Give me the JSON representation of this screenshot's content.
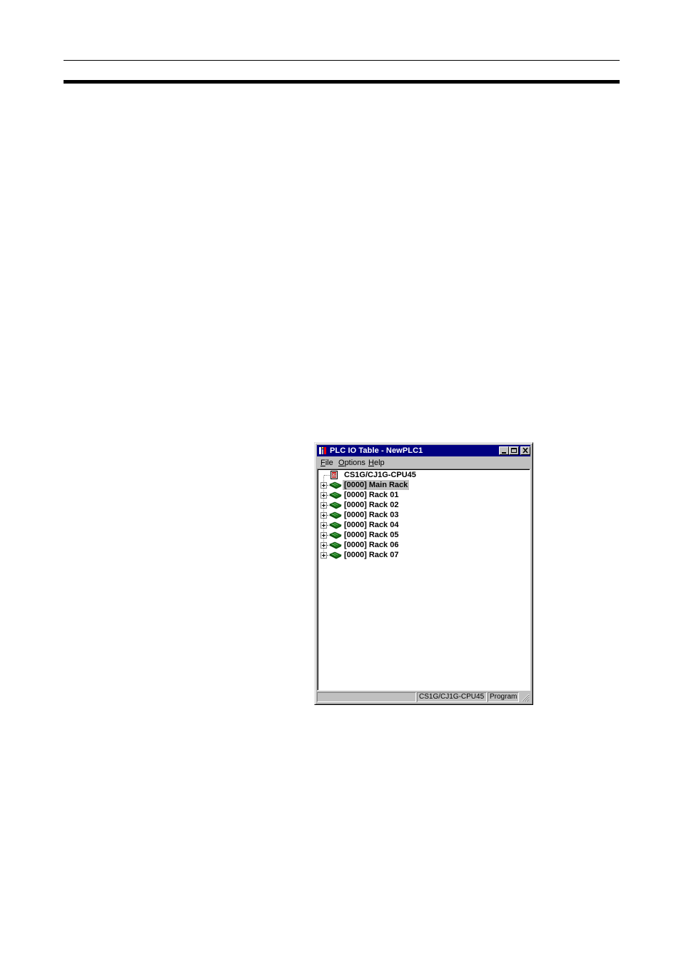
{
  "window": {
    "title": "PLC IO Table - NewPLC1",
    "icon": "plc-io-table-app-icon"
  },
  "title_buttons": {
    "minimize_icon": "minimize-icon",
    "maximize_icon": "maximize-icon",
    "close_icon": "close-icon"
  },
  "menu": {
    "items": [
      {
        "accel": "F",
        "rest": "ile"
      },
      {
        "accel": "O",
        "rest": "ptions"
      },
      {
        "accel": "H",
        "rest": "elp"
      }
    ]
  },
  "tree": {
    "root": {
      "label": "CS1G/CJ1G-CPU45",
      "icon": "cpu-icon"
    },
    "nodes": [
      {
        "label": "[0000] Main Rack",
        "icon": "rack-icon",
        "selected": true
      },
      {
        "label": "[0000] Rack 01",
        "icon": "rack-icon"
      },
      {
        "label": "[0000] Rack 02",
        "icon": "rack-icon"
      },
      {
        "label": "[0000] Rack 03",
        "icon": "rack-icon"
      },
      {
        "label": "[0000] Rack 04",
        "icon": "rack-icon"
      },
      {
        "label": "[0000] Rack 05",
        "icon": "rack-icon"
      },
      {
        "label": "[0000] Rack 06",
        "icon": "rack-icon"
      },
      {
        "label": "[0000] Rack 07",
        "icon": "rack-icon"
      }
    ]
  },
  "statusbar": {
    "model": "CS1G/CJ1G-CPU45",
    "mode": "Program"
  },
  "colors": {
    "titlebar": "#000080",
    "face": "#c0c0c0",
    "rack_green": "#1f7a1f"
  }
}
